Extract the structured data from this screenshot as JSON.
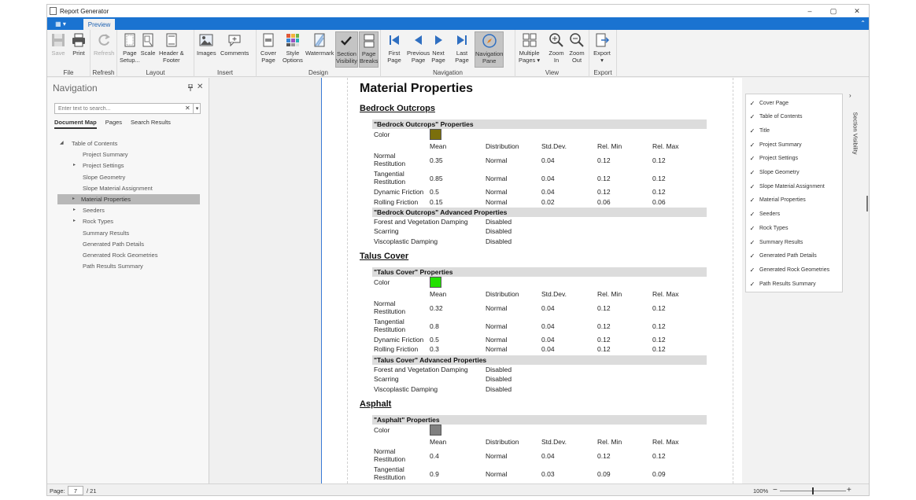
{
  "window": {
    "title": "Report Generator",
    "controls": {
      "minimize": "–",
      "maximize": "▢",
      "close": "✕"
    }
  },
  "tabs": {
    "menu": "▦ ▾",
    "active": "Preview",
    "collapse": "⌃"
  },
  "ribbon": {
    "groups": [
      {
        "name": "File",
        "buttons": [
          {
            "label": "Save",
            "icon": "save-icon",
            "enabled": false
          },
          {
            "label": "Print",
            "icon": "print-icon",
            "enabled": true
          }
        ]
      },
      {
        "name": "Refresh",
        "buttons": [
          {
            "label": "Refresh",
            "icon": "refresh-icon",
            "enabled": false
          }
        ]
      },
      {
        "name": "Layout",
        "buttons": [
          {
            "label": "Page\nSetup...",
            "icon": "page-setup-icon"
          },
          {
            "label": "Scale",
            "icon": "scale-icon"
          },
          {
            "label": "Header &\nFooter",
            "icon": "header-footer-icon"
          }
        ]
      },
      {
        "name": "Insert",
        "buttons": [
          {
            "label": "Images",
            "icon": "images-icon"
          },
          {
            "label": "Comments",
            "icon": "comments-icon"
          }
        ]
      },
      {
        "name": "Design",
        "buttons": [
          {
            "label": "Cover\nPage",
            "icon": "cover-page-icon"
          },
          {
            "label": "Style\nOptions",
            "icon": "style-options-icon"
          },
          {
            "label": "Watermark",
            "icon": "watermark-icon"
          },
          {
            "label": "Section\nVisibility",
            "icon": "checkmark-icon",
            "active": true
          },
          {
            "label": "Page\nBreaks",
            "icon": "page-breaks-icon",
            "active": true
          }
        ]
      },
      {
        "name": "Navigation",
        "buttons": [
          {
            "label": "First\nPage",
            "icon": "first-page-icon"
          },
          {
            "label": "Previous\nPage",
            "icon": "previous-page-icon"
          },
          {
            "label": "Next\nPage",
            "icon": "next-page-icon"
          },
          {
            "label": "Last\nPage",
            "icon": "last-page-icon"
          },
          {
            "label": "Navigation\nPane",
            "icon": "compass-icon",
            "active": true
          }
        ]
      },
      {
        "name": "View",
        "buttons": [
          {
            "label": "Multiple\nPages ▾",
            "icon": "multiple-pages-icon"
          },
          {
            "label": "Zoom\nIn",
            "icon": "zoom-in-icon"
          },
          {
            "label": "Zoom\nOut",
            "icon": "zoom-out-icon"
          }
        ]
      },
      {
        "name": "Export",
        "buttons": [
          {
            "label": "Export\n▾",
            "icon": "export-icon"
          }
        ]
      }
    ]
  },
  "navigation": {
    "header": "Navigation",
    "pin": "📌",
    "close": "✕",
    "search_placeholder": "Enter text to search...",
    "search_clear": "✕",
    "search_dropdown": "▾",
    "tabs": [
      "Document Map",
      "Pages",
      "Search Results"
    ],
    "active_tab": "Document Map",
    "tree": [
      {
        "label": "Table of Contents",
        "level": 0,
        "arrow": "◢"
      },
      {
        "label": "Project Summary",
        "level": 1,
        "arrow": ""
      },
      {
        "label": "Project Settings",
        "level": 1,
        "arrow": "▸"
      },
      {
        "label": "Slope Geometry",
        "level": 1,
        "arrow": ""
      },
      {
        "label": "Slope Material Assignment",
        "level": 1,
        "arrow": ""
      },
      {
        "label": "Material Properties",
        "level": 1,
        "arrow": "▸",
        "selected": true
      },
      {
        "label": "Seeders",
        "level": 1,
        "arrow": "▸"
      },
      {
        "label": "Rock Types",
        "level": 1,
        "arrow": "▸"
      },
      {
        "label": "Summary Results",
        "level": 1,
        "arrow": ""
      },
      {
        "label": "Generated Path Details",
        "level": 1,
        "arrow": ""
      },
      {
        "label": "Generated Rock Geometries",
        "level": 1,
        "arrow": ""
      },
      {
        "label": "Path Results Summary",
        "level": 1,
        "arrow": ""
      }
    ]
  },
  "report": {
    "title": "Material Properties",
    "col_headers": [
      "Mean",
      "Distribution",
      "Std.Dev.",
      "Rel. Min",
      "Rel. Max"
    ],
    "color_label": "Color",
    "materials": [
      {
        "name": "Bedrock Outcrops",
        "props_header": "\"Bedrock Outcrops\" Properties",
        "color": "#7b6f0c",
        "rows": [
          {
            "label": "Normal\nRestitution",
            "mean": "0.35",
            "dist": "Normal",
            "std": "0.04",
            "min": "0.12",
            "max": "0.12"
          },
          {
            "label": "Tangential\nRestitution",
            "mean": "0.85",
            "dist": "Normal",
            "std": "0.04",
            "min": "0.12",
            "max": "0.12"
          },
          {
            "label": "Dynamic Friction",
            "mean": "0.5",
            "dist": "Normal",
            "std": "0.04",
            "min": "0.12",
            "max": "0.12"
          },
          {
            "label": "Rolling Friction",
            "mean": "0.15",
            "dist": "Normal",
            "std": "0.02",
            "min": "0.06",
            "max": "0.06"
          }
        ],
        "adv_header": "\"Bedrock Outcrops\" Advanced Properties",
        "advanced": [
          {
            "label": "Forest and Vegetation Damping",
            "value": "Disabled"
          },
          {
            "label": "Scarring",
            "value": "Disabled"
          },
          {
            "label": "Viscoplastic Damping",
            "value": "Disabled"
          }
        ]
      },
      {
        "name": "Talus Cover",
        "props_header": "\"Talus Cover\" Properties",
        "color": "#22e000",
        "rows": [
          {
            "label": "Normal\nRestitution",
            "mean": "0.32",
            "dist": "Normal",
            "std": "0.04",
            "min": "0.12",
            "max": "0.12"
          },
          {
            "label": "Tangential\nRestitution",
            "mean": "0.8",
            "dist": "Normal",
            "std": "0.04",
            "min": "0.12",
            "max": "0.12"
          },
          {
            "label": "Dynamic Friction",
            "mean": "0.5",
            "dist": "Normal",
            "std": "0.04",
            "min": "0.12",
            "max": "0.12"
          },
          {
            "label": "Rolling Friction",
            "mean": "0.3",
            "dist": "Normal",
            "std": "0.04",
            "min": "0.12",
            "max": "0.12"
          }
        ],
        "adv_header": "\"Talus Cover\" Advanced Properties",
        "advanced": [
          {
            "label": "Forest and Vegetation Damping",
            "value": "Disabled"
          },
          {
            "label": "Scarring",
            "value": "Disabled"
          },
          {
            "label": "Viscoplastic Damping",
            "value": "Disabled"
          }
        ]
      },
      {
        "name": "Asphalt",
        "props_header": "\"Asphalt\" Properties",
        "color": "#808080",
        "rows": [
          {
            "label": "Normal\nRestitution",
            "mean": "0.4",
            "dist": "Normal",
            "std": "0.04",
            "min": "0.12",
            "max": "0.12"
          },
          {
            "label": "Tangential\nRestitution",
            "mean": "0.9",
            "dist": "Normal",
            "std": "0.03",
            "min": "0.09",
            "max": "0.09"
          }
        ],
        "adv_header": "",
        "advanced": []
      }
    ]
  },
  "section_visibility": {
    "tab_label": "Section Visibility",
    "collapse": "›",
    "items": [
      {
        "label": "Cover Page",
        "checked": true
      },
      {
        "label": "Table of Contents",
        "checked": true
      },
      {
        "label": "Title",
        "checked": true
      },
      {
        "label": "Project Summary",
        "checked": true
      },
      {
        "label": "Project Settings",
        "checked": true
      },
      {
        "label": "Slope Geometry",
        "checked": true
      },
      {
        "label": "Slope Material Assignment",
        "checked": true
      },
      {
        "label": "Material Properties",
        "checked": true
      },
      {
        "label": "Seeders",
        "checked": true
      },
      {
        "label": "Rock Types",
        "checked": true
      },
      {
        "label": "Summary Results",
        "checked": true
      },
      {
        "label": "Generated Path Details",
        "checked": true
      },
      {
        "label": "Generated Rock Geometries",
        "checked": true
      },
      {
        "label": "Path Results Summary",
        "checked": true
      }
    ]
  },
  "status": {
    "page_label": "Page:",
    "page": "7",
    "total": "/ 21",
    "zoom": "100%",
    "zoom_minus": "−",
    "zoom_plus": "+"
  },
  "colors": {
    "accent": "#1a73d1",
    "selected_tree": "#b8b8b8",
    "page_border": "#3a7bd5"
  }
}
